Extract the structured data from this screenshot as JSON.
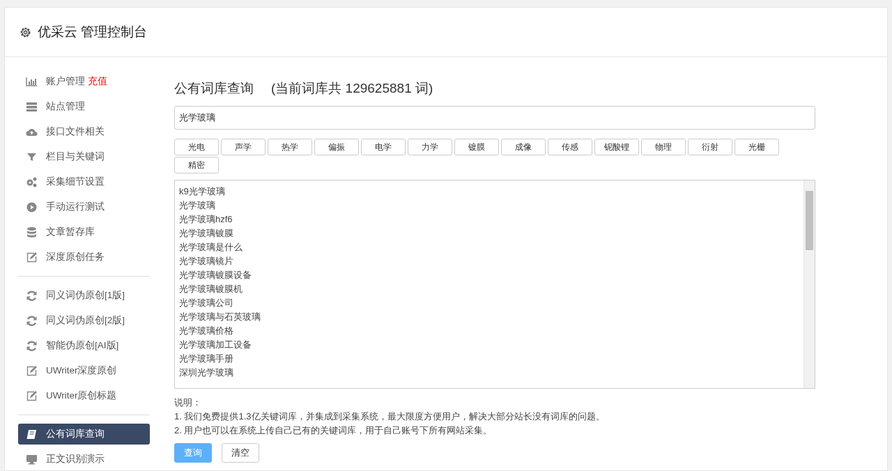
{
  "header": {
    "title": "优采云 管理控制台"
  },
  "sidebar": {
    "groups": [
      {
        "items": [
          {
            "kind": "chart",
            "label": "账户管理",
            "badge": "充值",
            "selected": false
          },
          {
            "kind": "server",
            "label": "站点管理",
            "selected": false
          },
          {
            "kind": "cloud",
            "label": "接口文件相关",
            "selected": false
          },
          {
            "kind": "filter",
            "label": "栏目与关键词",
            "selected": false
          },
          {
            "kind": "gears",
            "label": "采集细节设置",
            "selected": false
          },
          {
            "kind": "play",
            "label": "手动运行测试",
            "selected": false
          },
          {
            "kind": "database",
            "label": "文章暂存库",
            "selected": false
          },
          {
            "kind": "edit",
            "label": "深度原创任务",
            "selected": false
          }
        ]
      },
      {
        "items": [
          {
            "kind": "refresh",
            "label": "同义词伪原创[1版]",
            "selected": false
          },
          {
            "kind": "refresh",
            "label": "同义词伪原创[2版]",
            "selected": false
          },
          {
            "kind": "refresh",
            "label": "智能伪原创[AI版]",
            "selected": false
          },
          {
            "kind": "edit",
            "label": "UWriter深度原创",
            "selected": false
          },
          {
            "kind": "edit",
            "label": "UWriter原创标题",
            "selected": false
          }
        ]
      },
      {
        "items": [
          {
            "kind": "book",
            "label": "公有词库查询",
            "selected": true
          },
          {
            "kind": "monitor",
            "label": "正文识别演示",
            "selected": false
          }
        ]
      }
    ]
  },
  "main": {
    "title": "公有词库查询",
    "count_text": "(当前词库共 129625881 词)",
    "search": {
      "value": "光学玻璃"
    },
    "tags": [
      "光电",
      "声学",
      "热学",
      "偏振",
      "电学",
      "力学",
      "镀膜",
      "成像",
      "传感",
      "铌酸锂",
      "物理",
      "衍射",
      "光栅",
      "精密"
    ],
    "results": [
      "k9光学玻璃",
      "光学玻璃",
      "光学玻璃hzf6",
      "光学玻璃镀膜",
      "光学玻璃是什么",
      "光学玻璃镜片",
      "光学玻璃镀膜设备",
      "光学玻璃镀膜机",
      "光学玻璃公司",
      "光学玻璃与石英玻璃",
      "光学玻璃价格",
      "光学玻璃加工设备",
      "光学玻璃手册",
      "深圳光学玻璃"
    ],
    "notes_title": "说明：",
    "notes": [
      "1. 我们免费提供1.3亿关键词库，并集成到采集系统，最大限度方便用户，解决大部分站长没有词库的问题。",
      "2. 用户也可以在系统上传自己已有的关键词库，用于自己账号下所有网站采集。"
    ],
    "buttons": [
      {
        "label": "查询",
        "kind": "primary"
      },
      {
        "label": "清空",
        "kind": "default"
      }
    ]
  }
}
